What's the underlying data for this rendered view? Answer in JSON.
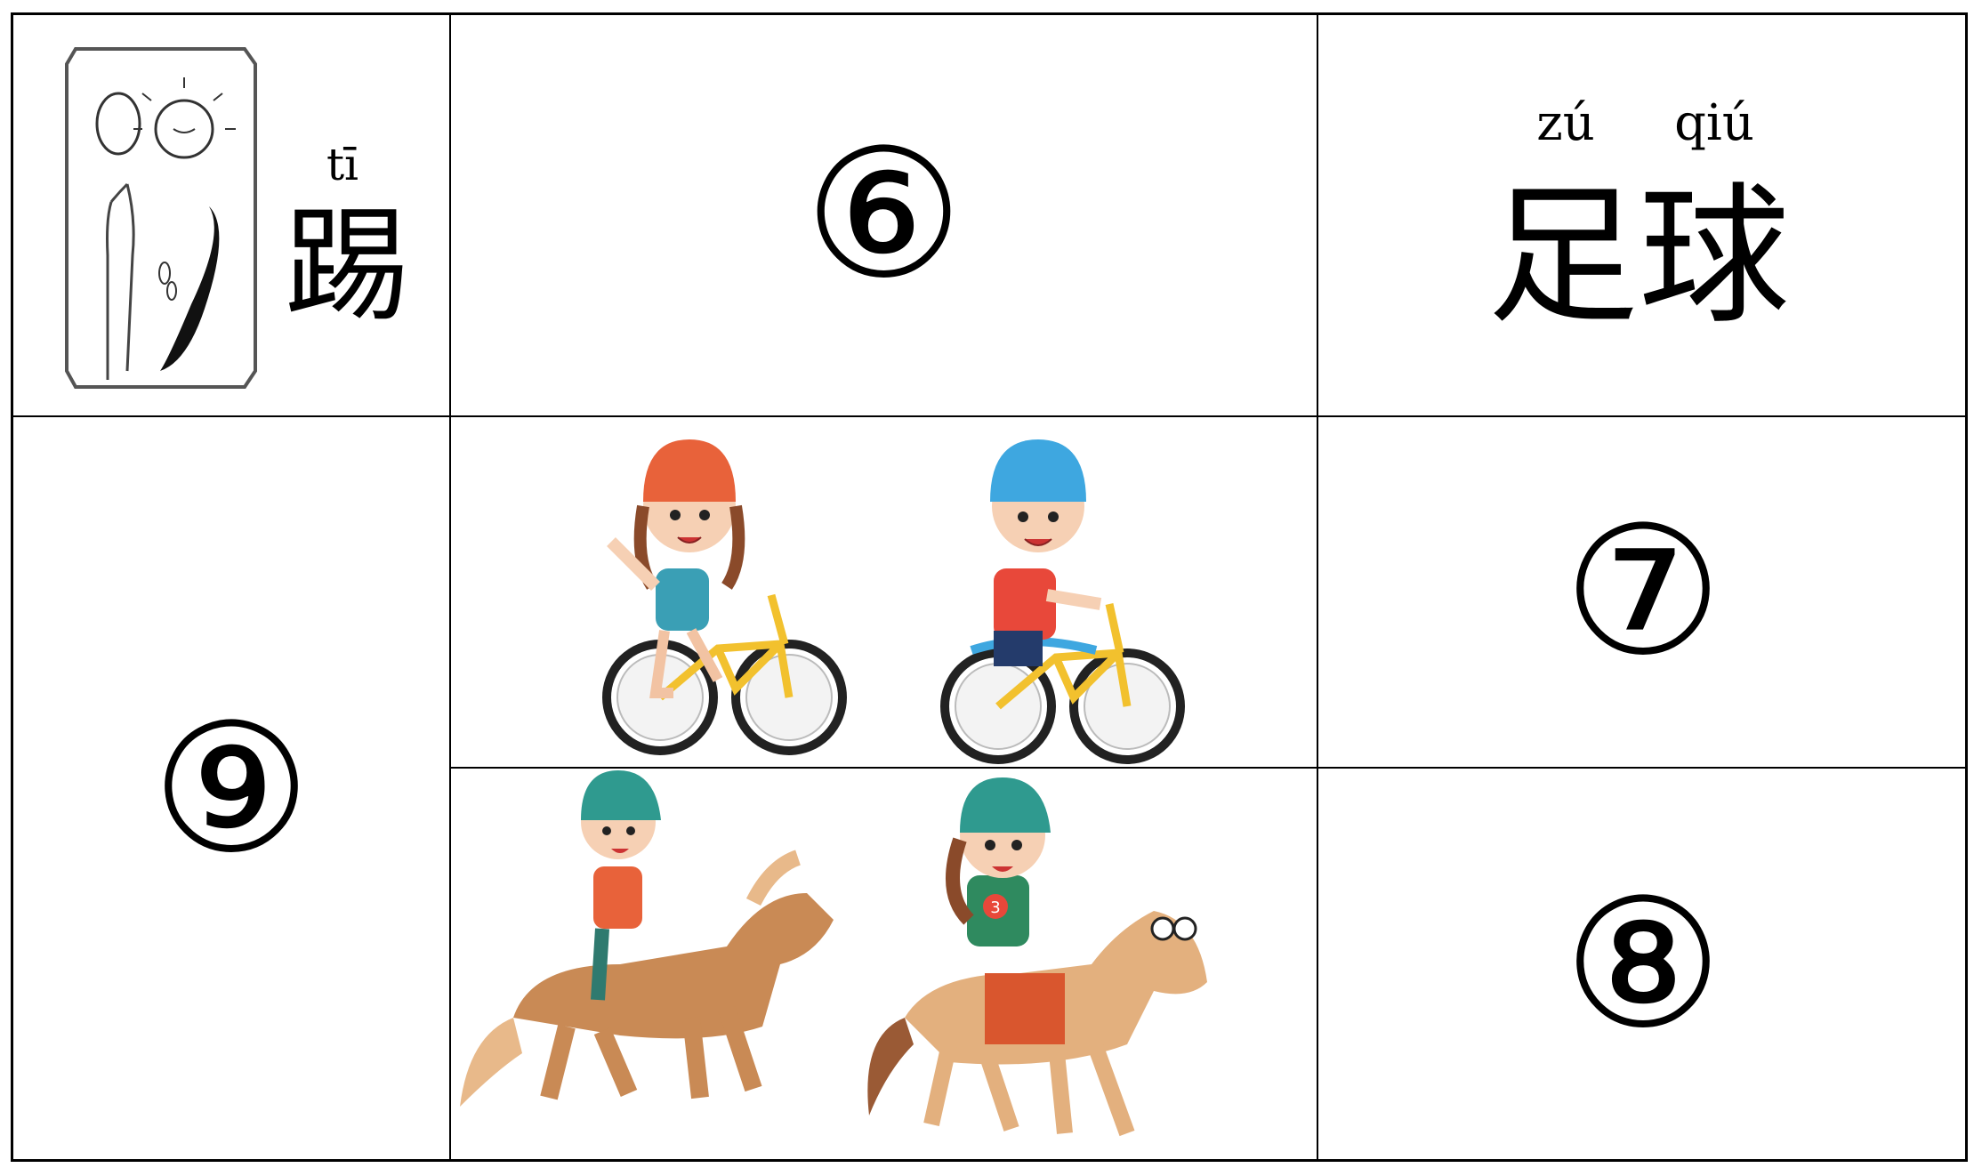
{
  "cells": {
    "ti": {
      "pinyin": "tī",
      "hanzi": "踢",
      "image": "kick-glyph-icon"
    },
    "six": "⑥",
    "zuqiu": {
      "pinyin": [
        "zú",
        "qiú"
      ],
      "hanzi": "足球"
    },
    "nine": "⑨",
    "seven": "⑦",
    "eight": "⑧",
    "bikes": {
      "image": "children-riding-bicycles-illustration",
      "riders": [
        "girl-cyclist",
        "boy-cyclist"
      ]
    },
    "horses": {
      "image": "children-riding-horses-illustration",
      "riders": [
        "boy-horse-rider",
        "girl-horse-rider"
      ],
      "jersey_number": "3"
    }
  },
  "colors": {
    "line": "#000000",
    "background": "#ffffff",
    "helmet_orange": "#e8623a",
    "helmet_blue": "#3ea7e0",
    "bike_yellow": "#f2c12e",
    "horse_brown": "#c98a55",
    "helmet_green": "#2f9a8f"
  }
}
